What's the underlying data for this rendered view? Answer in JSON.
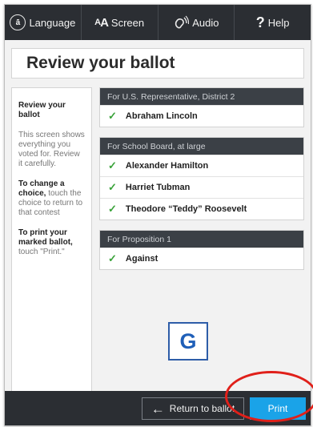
{
  "topbar": {
    "language": {
      "label": "Language",
      "icon": "language-icon"
    },
    "screen": {
      "label": "Screen",
      "icon_text": "AA"
    },
    "audio": {
      "label": "Audio",
      "icon": "audio-icon"
    },
    "help": {
      "label": "Help",
      "icon_text": "?"
    }
  },
  "page": {
    "title": "Review your ballot"
  },
  "sidebar": {
    "heading": "Review your ballot",
    "intro": "This screen shows everything you voted for. Review it carefully.",
    "change_bold": "To change a choice,",
    "change_rest": " touch the choice to return to that contest",
    "print_bold": "To print your marked ballot,",
    "print_rest": " touch \"Print.\""
  },
  "contests": [
    {
      "title": "For U.S. Representative, District 2",
      "choices": [
        "Abraham Lincoln"
      ]
    },
    {
      "title": "For School Board, at large",
      "choices": [
        "Alexander Hamilton",
        "Harriet Tubman",
        "Theodore “Teddy” Roosevelt"
      ]
    },
    {
      "title": "For Proposition 1",
      "choices": [
        "Against"
      ]
    }
  ],
  "marker": {
    "label": "G"
  },
  "bottombar": {
    "return_label": "Return to ballot",
    "print_label": "Print"
  },
  "colors": {
    "accent": "#1aa3e8",
    "bar": "#2b2e33",
    "check": "#3aa33a",
    "annotation": "#e0201a",
    "marker": "#2e5da8"
  }
}
